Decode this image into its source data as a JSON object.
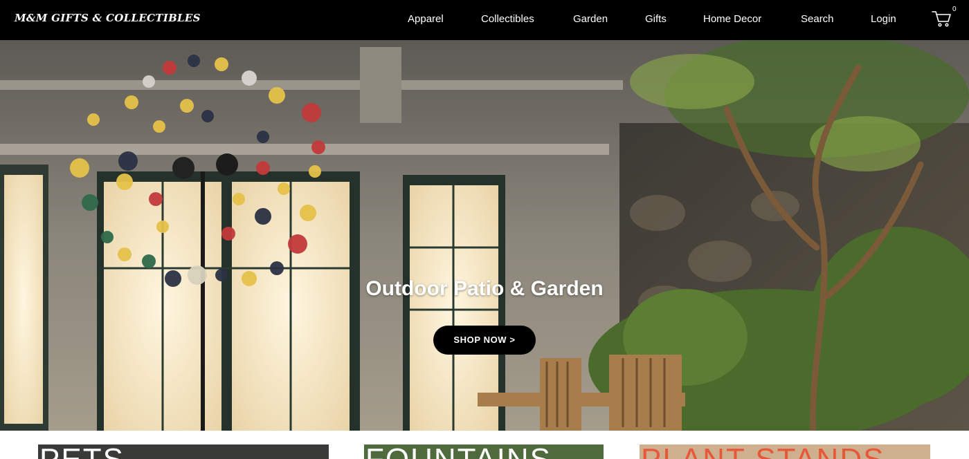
{
  "header": {
    "logo": "M&M GIFTS & COLLECTIBLES",
    "nav": [
      "Apparel",
      "Collectibles",
      "Garden",
      "Gifts",
      "Home Decor",
      "Search",
      "Login"
    ],
    "cart": {
      "icon": "cart-icon",
      "count": "0"
    }
  },
  "hero": {
    "title": "Outdoor Patio & Garden",
    "button_label": "SHOP NOW >"
  },
  "categories": [
    {
      "label": "PETS"
    },
    {
      "label": "FOUNTAINS"
    },
    {
      "label": "PLANT STANDS"
    }
  ],
  "colors": {
    "header_bg": "#000000",
    "button_bg": "#000000",
    "text": "#ffffff",
    "plant_stands_label": "#e7583b"
  }
}
